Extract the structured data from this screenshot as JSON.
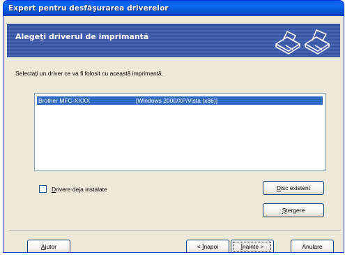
{
  "window": {
    "title": "Expert pentru desfăşurarea driverelor"
  },
  "header": {
    "title": "Alegeţi driverul de imprimantă",
    "icon": "printer-icon"
  },
  "instruction": "Selectaţi un driver ce va fi folosit cu această imprimantă.",
  "drivers": [
    {
      "name": "Brother MFC-XXXX",
      "platform": "[Windows 2000/XP/Vista (x86)]",
      "selected": true
    }
  ],
  "checkbox": {
    "label_prefix": "",
    "label_accel": "D",
    "label_rest": "rivere deja instalate",
    "checked": false
  },
  "buttons": {
    "disc": {
      "accel": "D",
      "rest": "isc existent"
    },
    "sterg": {
      "accel": "Ş",
      "rest": "tergere"
    },
    "help": {
      "accel": "A",
      "rest": "jutor"
    },
    "back_prefix": "< ",
    "back": {
      "accel": "Î",
      "rest": "napoi"
    },
    "next": {
      "accel": "Î",
      "rest": "nainte >"
    },
    "cancel": "Anulare"
  },
  "colors": {
    "title_bar": "#0a5ce8",
    "header_band": "#3b58a8",
    "selection": "#316ac5",
    "dialog": "#ece9d8"
  }
}
